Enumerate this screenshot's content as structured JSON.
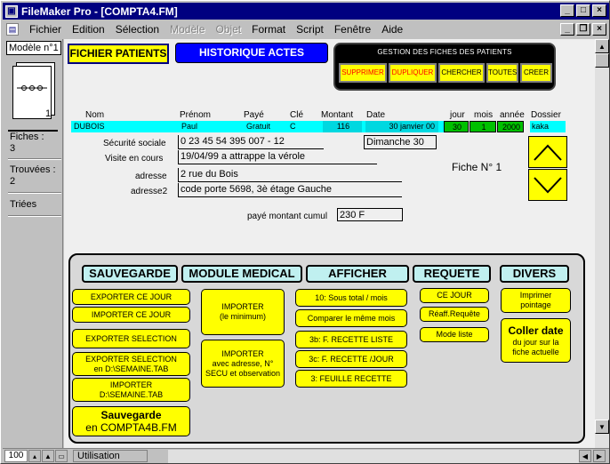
{
  "window": {
    "title": "FileMaker Pro - [COMPTA4.FM]",
    "app_icon": "filemaker-icon"
  },
  "menu": [
    "Fichier",
    "Edition",
    "Sélection",
    "Modèle",
    "Objet",
    "Format",
    "Script",
    "Fenêtre",
    "Aide"
  ],
  "status": {
    "layout": "Modèle n°1",
    "record_number": "1",
    "fiches_label": "Fiches :",
    "fiches_value": "3",
    "trouvees_label": "Trouvées :",
    "trouvees_value": "2",
    "triees_label": "Triées"
  },
  "bottom": {
    "zoom": "100",
    "mode": "Utilisation"
  },
  "tabs": {
    "patients": "FICHIER PATIENTS",
    "historique": "HISTORIQUE ACTES"
  },
  "gestion": {
    "title": "GESTION DES FICHES DES PATIENTS",
    "buttons": [
      "SUPPRIMER",
      "DUPLIQUER",
      "CHERCHER",
      "TOUTES",
      "CREER"
    ]
  },
  "labels": {
    "nom": "Nom",
    "prenom": "Prénom",
    "paye": "Payé",
    "cle": "Clé",
    "montant": "Montant",
    "date": "Date",
    "jour": "jour",
    "mois": "mois",
    "annee": "année",
    "dossier": "Dossier",
    "secu": "Sécurité sociale",
    "visite": "Visite en cours",
    "adresse": "adresse",
    "adresse2": "adresse2",
    "cumul": "payé montant cumul",
    "fiche": "Fiche N° 1"
  },
  "record": {
    "nom": "DUBOIS",
    "prenom": "Paul",
    "paye": "Gratuit",
    "cle": "C",
    "montant": "116",
    "date": "30 janvier 00",
    "jour": "30",
    "mois": "1",
    "annee": "2000",
    "dossier": "kaka",
    "secu": "0 23 45 54 395 007 - 12",
    "visite": "19/04/99   a attrappe la vérole",
    "day_name": "Dimanche 30",
    "adresse": "2 rue du Bois",
    "adresse2": "code porte 5698, 3è étage Gauche",
    "cumul": "230 F"
  },
  "sections": {
    "sauvegarde": "SAUVEGARDE",
    "medical": "MODULE MEDICAL",
    "afficher": "AFFICHER",
    "requete": "REQUETE",
    "divers": "DIVERS"
  },
  "buttons": {
    "export_jour": "EXPORTER  CE JOUR",
    "import_jour": "IMPORTER  CE JOUR",
    "export_sel": "EXPORTER SELECTION",
    "export_sem_1": "EXPORTER SELECTION",
    "export_sem_2": "en D:\\SEMAINE.TAB",
    "import_sem_1": "IMPORTER",
    "import_sem_2": "D:\\SEMAINE.TAB",
    "sauvegarde_1": "Sauvegarde",
    "sauvegarde_2": "en COMPTA4B.FM",
    "import_min_1": "IMPORTER",
    "import_min_2": "(le minimum)",
    "import_full_1": "IMPORTER",
    "import_full_2": "avec adresse, N°",
    "import_full_3": "SECU et observation",
    "sous_total": "10: Sous total / mois",
    "comparer": "Comparer le même mois",
    "recette_liste": "3b: F. RECETTE LISTE",
    "recette_jour": "3c: F. RECETTE /JOUR",
    "feuille": "3: FEUILLE RECETTE",
    "ce_jour": "CE JOUR",
    "reaff": "Réaff.Requête",
    "mode_liste": "Mode liste",
    "imprimer_1": "Imprimer",
    "imprimer_2": "pointage",
    "coller_1": "Coller date",
    "coller_2": "du jour sur la",
    "coller_3": "fiche actuelle"
  },
  "colors": {
    "title_bar": "#000080",
    "button_yellow": "#ffff00",
    "field_cyan": "#00ffff",
    "date_green": "#00c000",
    "tab_blue": "#0000ff"
  }
}
